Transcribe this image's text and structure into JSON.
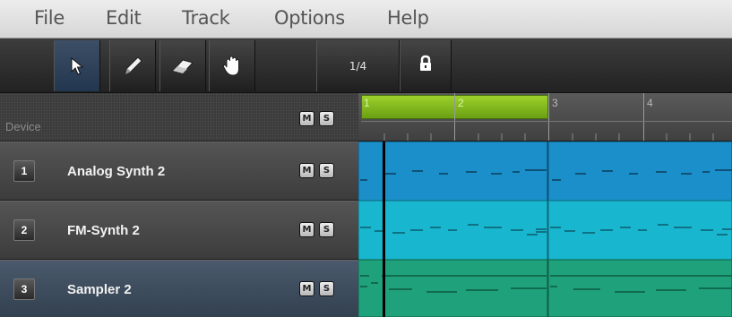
{
  "menu": [
    "File",
    "Edit",
    "Track",
    "Options",
    "Help"
  ],
  "toolbar": {
    "tools": [
      {
        "name": "pointer-tool",
        "icon": "arrow-cursor-icon",
        "active": true
      },
      {
        "name": "pencil-tool",
        "icon": "pencil-icon",
        "active": false
      },
      {
        "name": "eraser-tool",
        "icon": "eraser-icon",
        "active": false
      },
      {
        "name": "hand-tool",
        "icon": "hand-icon",
        "active": false
      }
    ],
    "quantize": "1/4",
    "lock_icon": "lock-icon"
  },
  "header": {
    "device_label": "Device",
    "mute_label": "M",
    "solo_label": "S"
  },
  "timeline": {
    "bars": [
      "1",
      "2",
      "3",
      "4"
    ],
    "loop_color": "#8bc220"
  },
  "tracks": [
    {
      "number": "1",
      "name": "Analog Synth 2",
      "mute": "M",
      "solo": "S",
      "selected": false,
      "clip_color": "#1a8fc9"
    },
    {
      "number": "2",
      "name": "FM-Synth 2",
      "mute": "M",
      "solo": "S",
      "selected": false,
      "clip_color": "#19b6d0"
    },
    {
      "number": "3",
      "name": "Sampler 2",
      "mute": "M",
      "solo": "S",
      "selected": true,
      "clip_color": "#1fa27b"
    }
  ]
}
